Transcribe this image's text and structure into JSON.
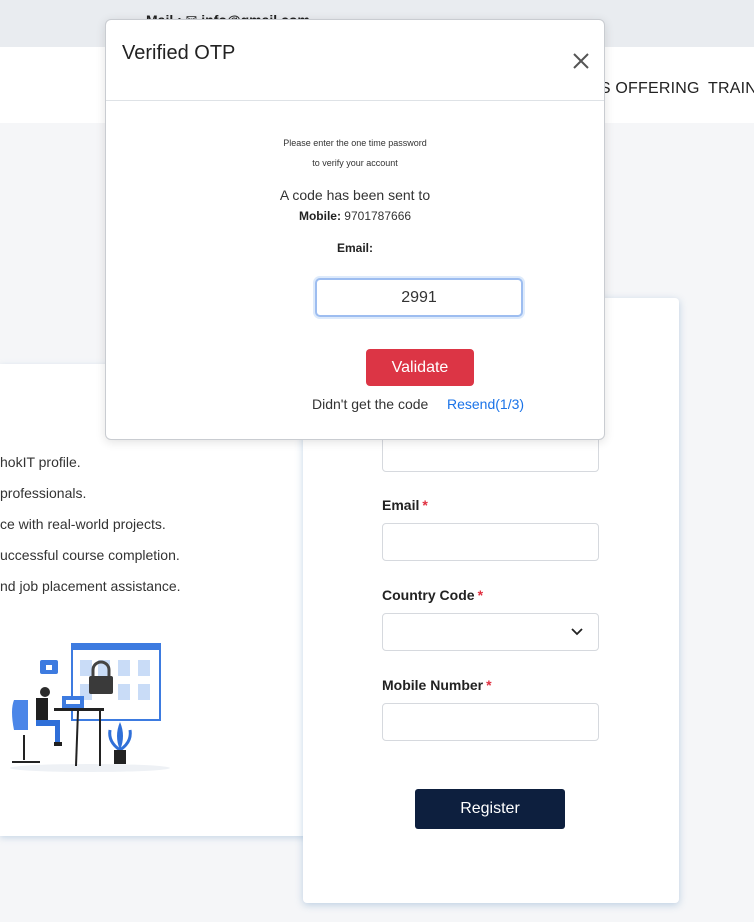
{
  "topbar": {
    "mail_text": "Mail : ✉ info@gmail.com"
  },
  "nav": {
    "items": [
      "ES OFFERING",
      "TRAIN"
    ]
  },
  "info": {
    "lines": [
      "hokIT profile.",
      "professionals.",
      "ce with real-world projects.",
      "uccessful course completion.",
      "nd job placement assistance."
    ]
  },
  "form": {
    "email_label": "Email",
    "country_label": "Country Code",
    "mobile_label": "Mobile Number",
    "required_mark": "*",
    "register_label": "Register"
  },
  "modal": {
    "title": "Verified OTP",
    "note_line1": "Please enter the one time password",
    "note_line2": "to verify your account",
    "sent_text": "A code has been sent to",
    "mobile_label": "Mobile:",
    "mobile_value": "9701787666",
    "email_label": "Email:",
    "otp_value": "2991",
    "validate_label": "Validate",
    "didnt_text": "Didn't get the code",
    "resend_text": "Resend(1/3)"
  },
  "colors": {
    "validate": "#dc3545",
    "register": "#0d1f3e",
    "link": "#1a73e8",
    "required": "#e03040"
  },
  "icons": [
    "close-icon",
    "chevron-down-icon",
    "mail-icon"
  ]
}
